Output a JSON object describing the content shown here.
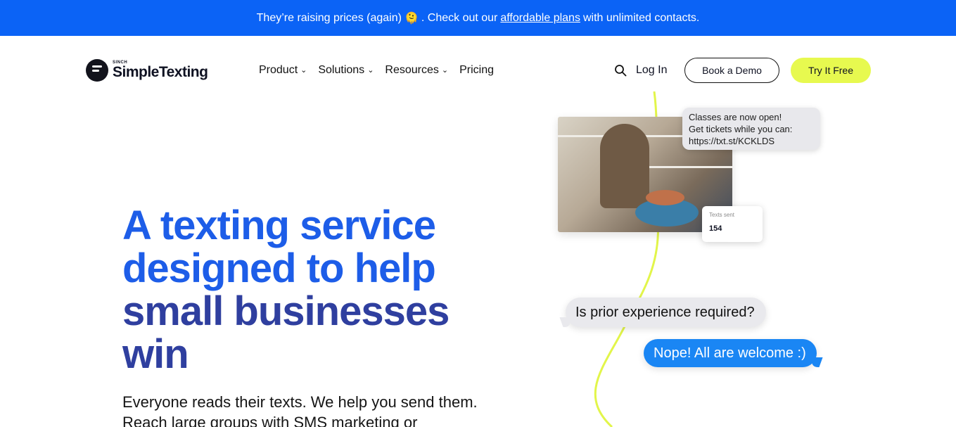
{
  "banner": {
    "text_before": "They’re raising prices (again)",
    "emoji": "🫠",
    "text_middle": ". Check out our",
    "link": "affordable plans",
    "text_after": "with unlimited contacts.",
    "background": "#0b63f6"
  },
  "header": {
    "logo": {
      "small": "SINCH",
      "name": "SimpleTexting",
      "icon": "chat-bubble-icon"
    },
    "menu": [
      {
        "label": "Product",
        "has_dropdown": true
      },
      {
        "label": "Solutions",
        "has_dropdown": true
      },
      {
        "label": "Resources",
        "has_dropdown": true
      },
      {
        "label": "Pricing",
        "has_dropdown": false
      }
    ],
    "search_icon": "search-icon",
    "login": "Log In",
    "demo_button": "Book a Demo",
    "try_button": "Try It Free",
    "try_button_color": "#e7f94f"
  },
  "hero": {
    "title_lines": [
      "A texting service",
      "designed to help",
      "small businesses",
      "win"
    ],
    "title_colors": [
      "#1d5de8",
      "#2f3f9f"
    ],
    "subtitle_lines": [
      "Everyone reads their texts. We help you send them.",
      "Reach large groups with SMS marketing or"
    ]
  },
  "visual": {
    "message_lines": [
      "Classes are now open!",
      "Get tickets while you can:",
      "https://txt.st/KCKLDS"
    ],
    "stat_label": "Texts sent",
    "stat_value": "154",
    "question": "Is prior experience required?",
    "answer": "Nope! All are welcome :)",
    "line_color": "#e2f54a",
    "answer_color": "#1a86f4"
  }
}
